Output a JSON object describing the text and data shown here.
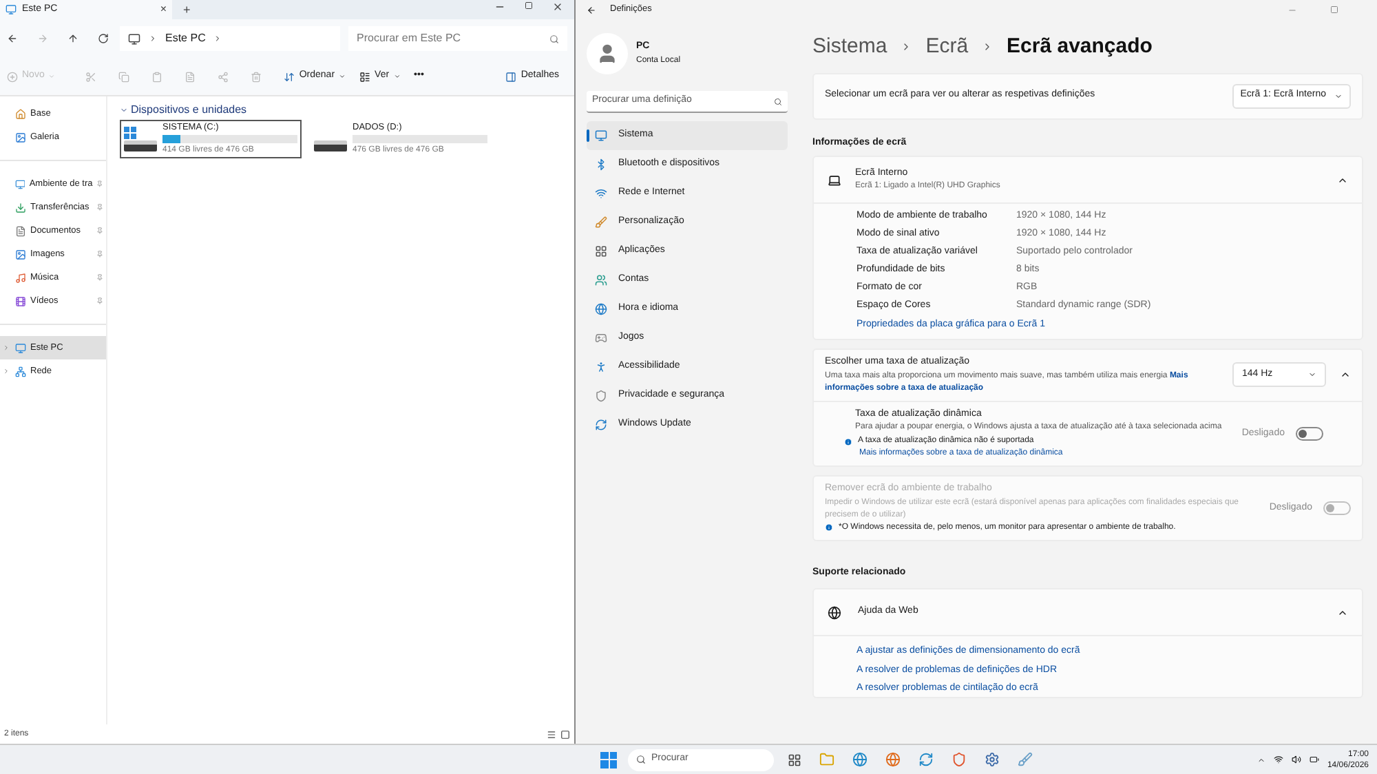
{
  "explorer": {
    "tab": {
      "title": "Este PC",
      "close": "×",
      "new_tab": "+"
    },
    "address": {
      "path": [
        "Este PC"
      ]
    },
    "search": {
      "placeholder": "Procurar em Este PC"
    },
    "toolbar": [
      {
        "kind": "new",
        "label": "Novo",
        "disabled": true
      },
      {
        "kind": "icons",
        "disabled": true
      },
      {
        "kind": "menu",
        "label": "Ordenar",
        "disabled": false
      },
      {
        "kind": "menu",
        "label": "Ver",
        "disabled": false
      },
      {
        "kind": "more",
        "label": "•••",
        "disabled": false
      }
    ],
    "details": "Detalhes",
    "sidebar": {
      "groups": [
        [
          {
            "label": "Base",
            "pinned": false,
            "expandable": false,
            "selected": false
          },
          {
            "label": "Galeria",
            "pinned": false,
            "expandable": false,
            "selected": false
          }
        ],
        [
          {
            "label": "Ambiente de tra",
            "pinned": true,
            "expandable": false,
            "selected": false
          },
          {
            "label": "Transferências",
            "pinned": true,
            "expandable": false,
            "selected": false
          },
          {
            "label": "Documentos",
            "pinned": true,
            "expandable": false,
            "selected": false
          },
          {
            "label": "Imagens",
            "pinned": true,
            "expandable": false,
            "selected": false
          },
          {
            "label": "Música",
            "pinned": true,
            "expandable": false,
            "selected": false
          },
          {
            "label": "Vídeos",
            "pinned": true,
            "expandable": false,
            "selected": false
          }
        ],
        [
          {
            "label": "Este PC",
            "pinned": false,
            "expandable": true,
            "selected": true
          },
          {
            "label": "Rede",
            "pinned": false,
            "expandable": true,
            "selected": false
          }
        ]
      ]
    },
    "group": {
      "title": "Dispositivos e unidades",
      "expanded": true
    },
    "drives": [
      {
        "kind": "system",
        "name": "SISTEMA (C:)",
        "level": 0.13,
        "free": "414 GB livres de 476 GB",
        "selected": true
      },
      {
        "kind": "data",
        "name": "DADOS (D:)",
        "level": 0.0,
        "free": "476 GB livres de 476 GB",
        "selected": false
      }
    ],
    "status_bar": {
      "count": "2 itens"
    }
  },
  "settings": {
    "window": {
      "title": "Definições"
    },
    "user": {
      "name": "PC",
      "account": "Conta Local"
    },
    "search": {
      "placeholder": "Procurar uma definição"
    },
    "nav": [
      {
        "label": "Sistema",
        "selected": true
      },
      {
        "label": "Bluetooth e dispositivos",
        "selected": false
      },
      {
        "label": "Rede e Internet",
        "selected": false
      },
      {
        "label": "Personalização",
        "selected": false
      },
      {
        "label": "Aplicações",
        "selected": false
      },
      {
        "label": "Contas",
        "selected": false
      },
      {
        "label": "Hora e idioma",
        "selected": false
      },
      {
        "label": "Jogos",
        "selected": false
      },
      {
        "label": "Acessibilidade",
        "selected": false
      },
      {
        "label": "Privacidade e segurança",
        "selected": false
      },
      {
        "label": "Windows Update",
        "selected": false
      }
    ],
    "breadcrumb": [
      "Sistema",
      "Ecrã",
      "Ecrã avançado"
    ],
    "display_select": {
      "label": "Selecionar um ecrã para ver ou alterar as respetivas definições",
      "value": "Ecrã 1: Ecrã Interno"
    },
    "info": {
      "heading": "Informações de ecrã",
      "title": "Ecrã Interno",
      "subtitle": "Ecrã 1: Ligado a Intel(R) UHD Graphics",
      "expanded": true,
      "rows": [
        {
          "label": "Modo de ambiente de trabalho",
          "value": "1920 × 1080, 144 Hz"
        },
        {
          "label": "Modo de sinal ativo",
          "value": "1920 × 1080, 144 Hz"
        },
        {
          "label": "Taxa de atualização variável",
          "value": "Suportado pelo controlador"
        },
        {
          "label": "Profundidade de bits",
          "value": "8 bits"
        },
        {
          "label": "Formato de cor",
          "value": "RGB"
        },
        {
          "label": "Espaço de Cores",
          "value": "Standard dynamic range (SDR)"
        }
      ],
      "link": "Propriedades da placa gráfica para o Ecrã 1"
    },
    "refresh": {
      "title": "Escolher uma taxa de atualização",
      "description": "Uma taxa mais alta proporciona um movimento mais suave, mas também utiliza mais energia **Mais informações sobre a taxa de atualização**",
      "value": "144 Hz",
      "expanded": true,
      "dynamic": {
        "title": "Taxa de atualização dinâmica",
        "description": "Para ajudar a poupar energia, o Windows ajusta a taxa de atualização até à taxa selecionada acima",
        "state": "Desligado",
        "on": false,
        "note": "A taxa de atualização dinâmica não é suportada",
        "link": "Mais informações sobre a taxa de atualização dinâmica"
      }
    },
    "remove": {
      "title": "Remover ecrã do ambiente de trabalho",
      "description": "Impedir o Windows de utilizar este ecrã (estará disponível apenas para aplicações com finalidades especiais que precisem de o utilizar)",
      "state": "Desligado",
      "on": false,
      "disabled": true,
      "note": "*O Windows necessita de, pelo menos, um monitor para apresentar o ambiente de trabalho."
    },
    "support": {
      "heading": "Suporte relacionado",
      "title": "Ajuda da Web",
      "expanded": true,
      "links": [
        "A ajustar as definições de dimensionamento do ecrã",
        "A resolver de problemas de definições de HDR",
        "A resolver problemas de cintilação do ecrã"
      ]
    }
  },
  "taskbar": {
    "search": {
      "placeholder": "Procurar"
    },
    "time": "17:00",
    "date": "14/06/2026"
  }
}
